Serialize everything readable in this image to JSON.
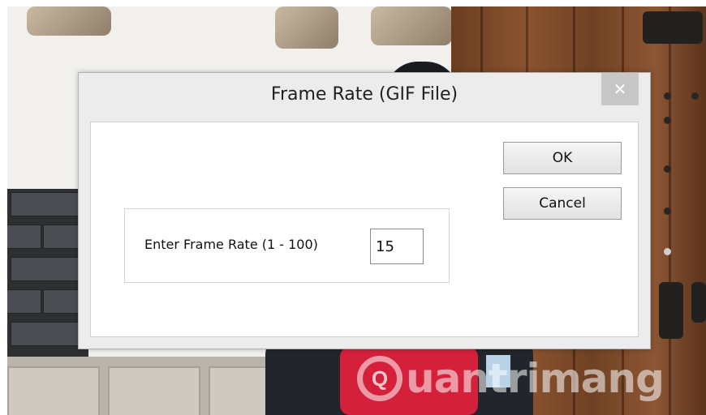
{
  "dialog": {
    "title": "Frame Rate (GIF File)",
    "close_glyph": "✕",
    "ok_label": "OK",
    "cancel_label": "Cancel",
    "field_label": "Enter Frame Rate (1 - 100)",
    "field_value": "15"
  },
  "watermark": {
    "text": "uantrimang",
    "icon": "lightbulb-q-icon"
  },
  "colors": {
    "dialog_bg": "#ececec",
    "close_button": "#c7c7c7",
    "client_bg": "#ffffff"
  }
}
